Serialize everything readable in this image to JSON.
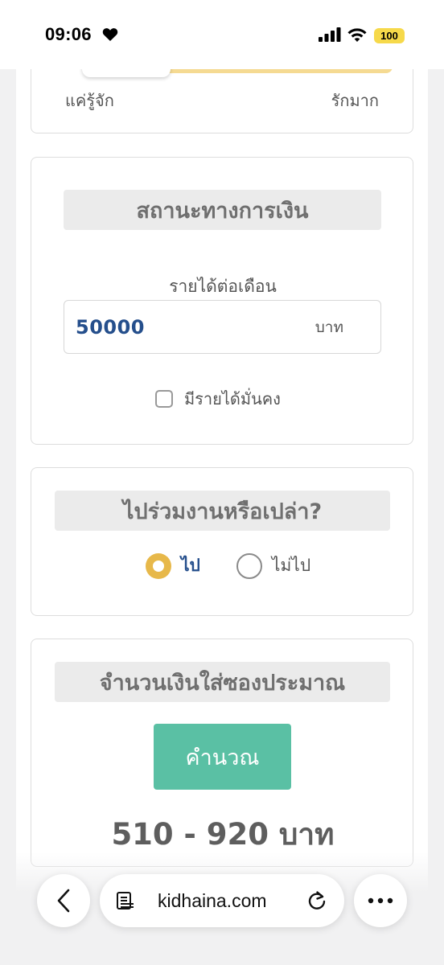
{
  "status_bar": {
    "time": "09:06",
    "battery": "100"
  },
  "slider": {
    "left_label": "แค่รู้จัก",
    "right_label": "รักมาก"
  },
  "finance": {
    "title": "สถานะทางการเงิน",
    "income_label": "รายได้ต่อเดือน",
    "income_value": "50000",
    "income_unit": "บาท",
    "stable_income_label": "มีรายได้มั่นคง",
    "stable_income_checked": false
  },
  "attendance": {
    "title": "ไปร่วมงานหรือเปล่า?",
    "options": [
      {
        "label": "ไป",
        "selected": true
      },
      {
        "label": "ไม่ไป",
        "selected": false
      }
    ]
  },
  "envelope": {
    "title": "จำนวนเงินใส่ซองประมาณ",
    "calculate_label": "คำนวณ",
    "result": "510 - 920 บาท"
  },
  "browser": {
    "url": "kidhaina.com"
  },
  "colors": {
    "accent_blue": "#254f8c",
    "radio_selected": "#e7b84a",
    "slider_fill": "#f5da92",
    "button_green": "#5ac0a4",
    "battery_yellow": "#f6d94a"
  }
}
